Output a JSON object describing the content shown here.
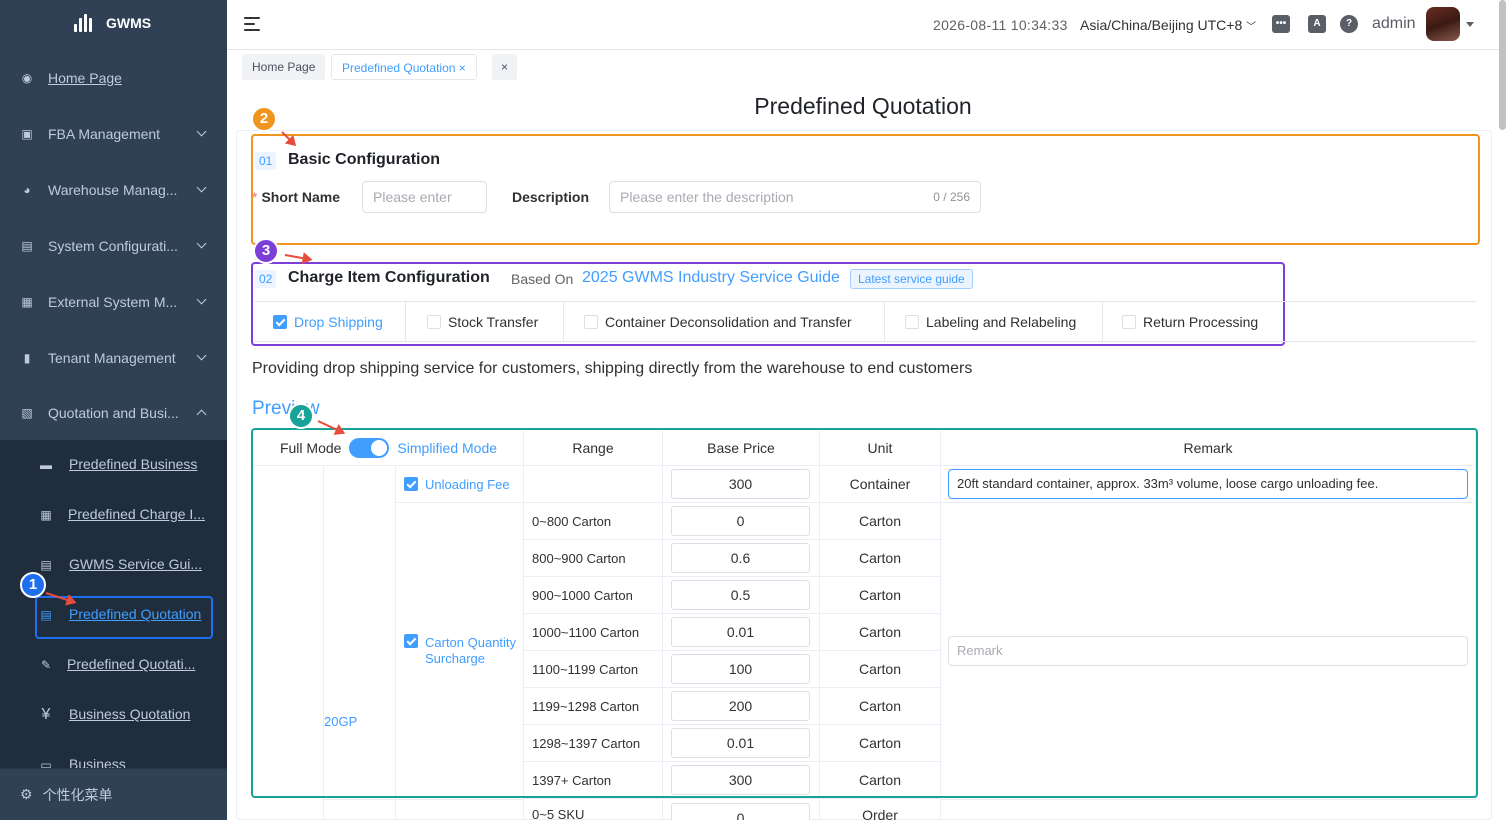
{
  "app": {
    "name": "GWMS"
  },
  "sidebar": {
    "items": [
      {
        "label": "Home Page",
        "icon": "dashboard-icon"
      },
      {
        "label": "FBA Management",
        "icon": "fba-icon"
      },
      {
        "label": "Warehouse Manag...",
        "icon": "warehouse-icon"
      },
      {
        "label": "System Configurati...",
        "icon": "system-icon"
      },
      {
        "label": "External System M...",
        "icon": "grid-icon"
      },
      {
        "label": "Tenant Management",
        "icon": "bar-chart-icon"
      },
      {
        "label": "Quotation and Busi...",
        "icon": "quotation-icon"
      }
    ],
    "sub_items": [
      {
        "label": "Predefined Business"
      },
      {
        "label": "Predefined Charge I..."
      },
      {
        "label": "GWMS Service Gui..."
      },
      {
        "label": "Predefined Quotation"
      },
      {
        "label": "Predefined Quotati..."
      },
      {
        "label": "Business Quotation"
      },
      {
        "label": "Business"
      }
    ],
    "footer": "个性化菜单"
  },
  "header": {
    "datetime": "2026-08-11 10:34:33",
    "timezone": "Asia/China/Beijing UTC+8",
    "user": "admin"
  },
  "tags": {
    "home": "Home Page",
    "current": "Predefined Quotation"
  },
  "page": {
    "title": "Predefined Quotation"
  },
  "annotations": {
    "a1": "1",
    "a2": "2",
    "a3": "3",
    "a4": "4"
  },
  "basic": {
    "num": "01",
    "title": "Basic Configuration",
    "short_name_label": "Short Name",
    "short_name_placeholder": "Please enter",
    "description_label": "Description",
    "description_placeholder": "Please enter the description",
    "counter": "0 / 256"
  },
  "charge": {
    "num": "02",
    "title": "Charge Item Configuration",
    "based_on": "Based On",
    "guide_name": "2025 GWMS Industry Service Guide",
    "guide_tag": "Latest service guide",
    "tabs": [
      {
        "label": "Drop Shipping",
        "checked": true
      },
      {
        "label": "Stock Transfer",
        "checked": false
      },
      {
        "label": "Container Deconsolidation and Transfer",
        "checked": false
      },
      {
        "label": "Labeling and Relabeling",
        "checked": false
      },
      {
        "label": "Return Processing",
        "checked": false
      }
    ],
    "description": "Providing drop shipping service for customers, shipping directly from the warehouse to end customers"
  },
  "preview": {
    "title": "Preview",
    "full_mode": "Full Mode",
    "simplified_mode": "Simplified Mode",
    "headers": {
      "range": "Range",
      "base_price": "Base Price",
      "unit": "Unit",
      "remark": "Remark"
    },
    "container": "20GP",
    "unloading": {
      "label": "Unloading Fee",
      "price": "300",
      "unit": "Container",
      "remark": "20ft standard container, approx. 33m³ volume, loose cargo unloading fee."
    },
    "carton_label": "Carton Quantity Surcharge",
    "remark_placeholder": "Remark",
    "rows": [
      {
        "range": "0~800 Carton",
        "price": "0",
        "unit": "Carton"
      },
      {
        "range": "800~900 Carton",
        "price": "0.6",
        "unit": "Carton"
      },
      {
        "range": "900~1000 Carton",
        "price": "0.5",
        "unit": "Carton"
      },
      {
        "range": "1000~1100 Carton",
        "price": "0.01",
        "unit": "Carton"
      },
      {
        "range": "1100~1199 Carton",
        "price": "100",
        "unit": "Carton"
      },
      {
        "range": "1199~1298 Carton",
        "price": "200",
        "unit": "Carton"
      },
      {
        "range": "1298~1397 Carton",
        "price": "0.01",
        "unit": "Carton"
      },
      {
        "range": "1397+ Carton",
        "price": "300",
        "unit": "Carton"
      }
    ],
    "next_row": {
      "range": "0~5 SKU",
      "price": "0",
      "unit": "Order"
    }
  }
}
